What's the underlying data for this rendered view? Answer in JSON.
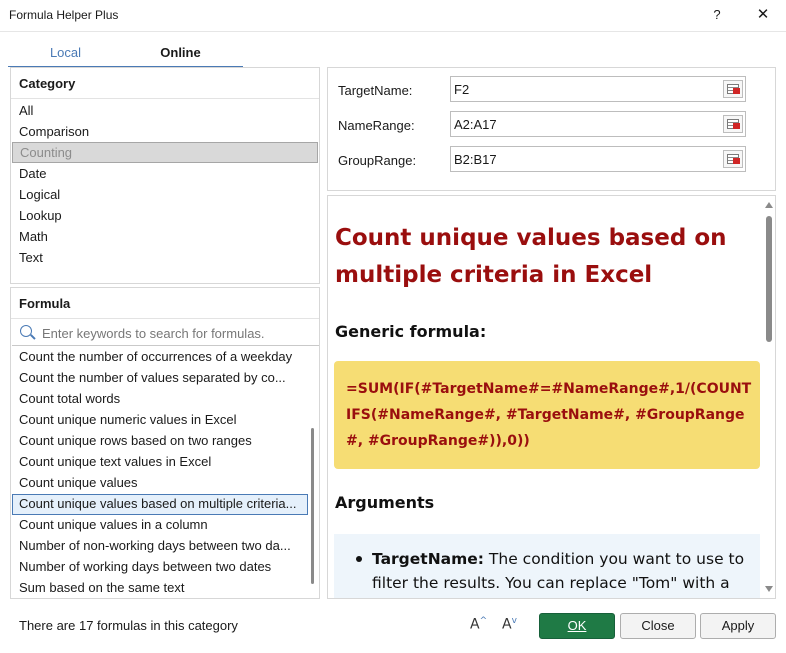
{
  "window": {
    "title": "Formula Helper Plus",
    "help_glyph": "?",
    "close_glyph": "✕"
  },
  "tabs": [
    {
      "label": "Local",
      "active": false
    },
    {
      "label": "Online",
      "active": true
    }
  ],
  "category": {
    "title": "Category",
    "items": [
      "All",
      "Comparison",
      "Counting",
      "Date",
      "Logical",
      "Lookup",
      "Math",
      "Text"
    ],
    "selected": "Counting"
  },
  "formula_list": {
    "title": "Formula",
    "search_placeholder": "Enter keywords to search for formulas.",
    "items": [
      "Count the number of occurrences of a weekday",
      "Count the number of values separated by co...",
      "Count total words",
      "Count unique numeric values in Excel",
      "Count unique rows based on two ranges",
      "Count unique text values in Excel",
      "Count unique values",
      "Count unique values based on multiple criteria...",
      "Count unique values in a column",
      "Number of non-working days between two da...",
      "Number of working days between two dates",
      "Sum based on the same text"
    ],
    "selected": "Count unique values based on multiple criteria..."
  },
  "fields": [
    {
      "label": "TargetName:",
      "value": "F2"
    },
    {
      "label": "NameRange:",
      "value": "A2:A17"
    },
    {
      "label": "GroupRange:",
      "value": "B2:B17"
    }
  ],
  "doc": {
    "title": "Count unique values based on multiple criteria in Excel",
    "generic_heading": "Generic formula:",
    "formula": "=SUM(IF(#TargetName#=#NameRange#,1/(COUNTIFS(#NameRange#, #TargetName#, #GroupRange#, #GroupRange#)),0))",
    "arguments_heading": "Arguments",
    "arg_name": "TargetName:",
    "arg_desc": " The condition you want to use to filter the results. You can replace \"Tom\" with a reference to"
  },
  "footer": {
    "status": "There are 17 formulas in this category",
    "font_increase": "A",
    "font_decrease": "A",
    "ok": "OK",
    "close": "Close",
    "apply": "Apply"
  },
  "colors": {
    "accent": "#4a7ab5",
    "title_red": "#9a0e0e",
    "formula_bg": "#f6dd74",
    "ok_green": "#1f7a45"
  }
}
